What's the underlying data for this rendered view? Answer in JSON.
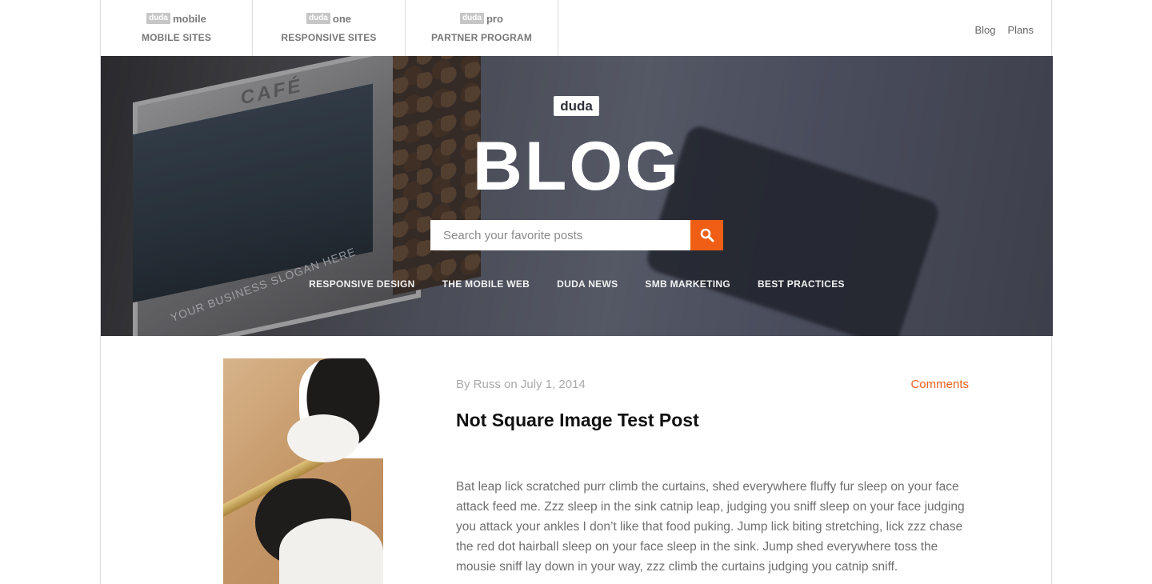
{
  "topnav": {
    "products": [
      {
        "badge": "duda",
        "name": "mobile",
        "label": "MOBILE SITES"
      },
      {
        "badge": "duda",
        "name": "one",
        "label": "RESPONSIVE SITES"
      },
      {
        "badge": "duda",
        "name": "pro",
        "label": "PARTNER PROGRAM"
      }
    ],
    "links": [
      "Blog",
      "Plans"
    ]
  },
  "hero": {
    "logo": "duda",
    "title": "BLOG",
    "search_placeholder": "Search your favorite posts",
    "mock_cafe": "CAFÉ",
    "mock_slogan": "YOUR BUSINESS SLOGAN HERE",
    "categories": [
      "RESPONSIVE DESIGN",
      "THE MOBILE WEB",
      "DUDA NEWS",
      "SMB MARKETING",
      "BEST PRACTICES"
    ]
  },
  "post": {
    "meta": "By Russ on July 1, 2014",
    "comments": "Comments",
    "title": "Not Square Image Test Post",
    "body": "Bat leap lick scratched purr climb the curtains, shed everywhere fluffy fur sleep on your face attack feed me. Zzz sleep in the sink catnip leap, judging you sniff sleep on your face judging you attack your ankles I don’t like that food puking. Jump lick biting stretching, lick zzz chase the red dot hairball sleep on your face sleep in the sink. Jump shed everywhere toss the mousie sniff lay down in your way, zzz climb the curtains judging you catnip sniff."
  },
  "colors": {
    "accent": "#ef5e14",
    "comments": "#e8601c"
  },
  "icons": {
    "search_button": "search-icon"
  }
}
